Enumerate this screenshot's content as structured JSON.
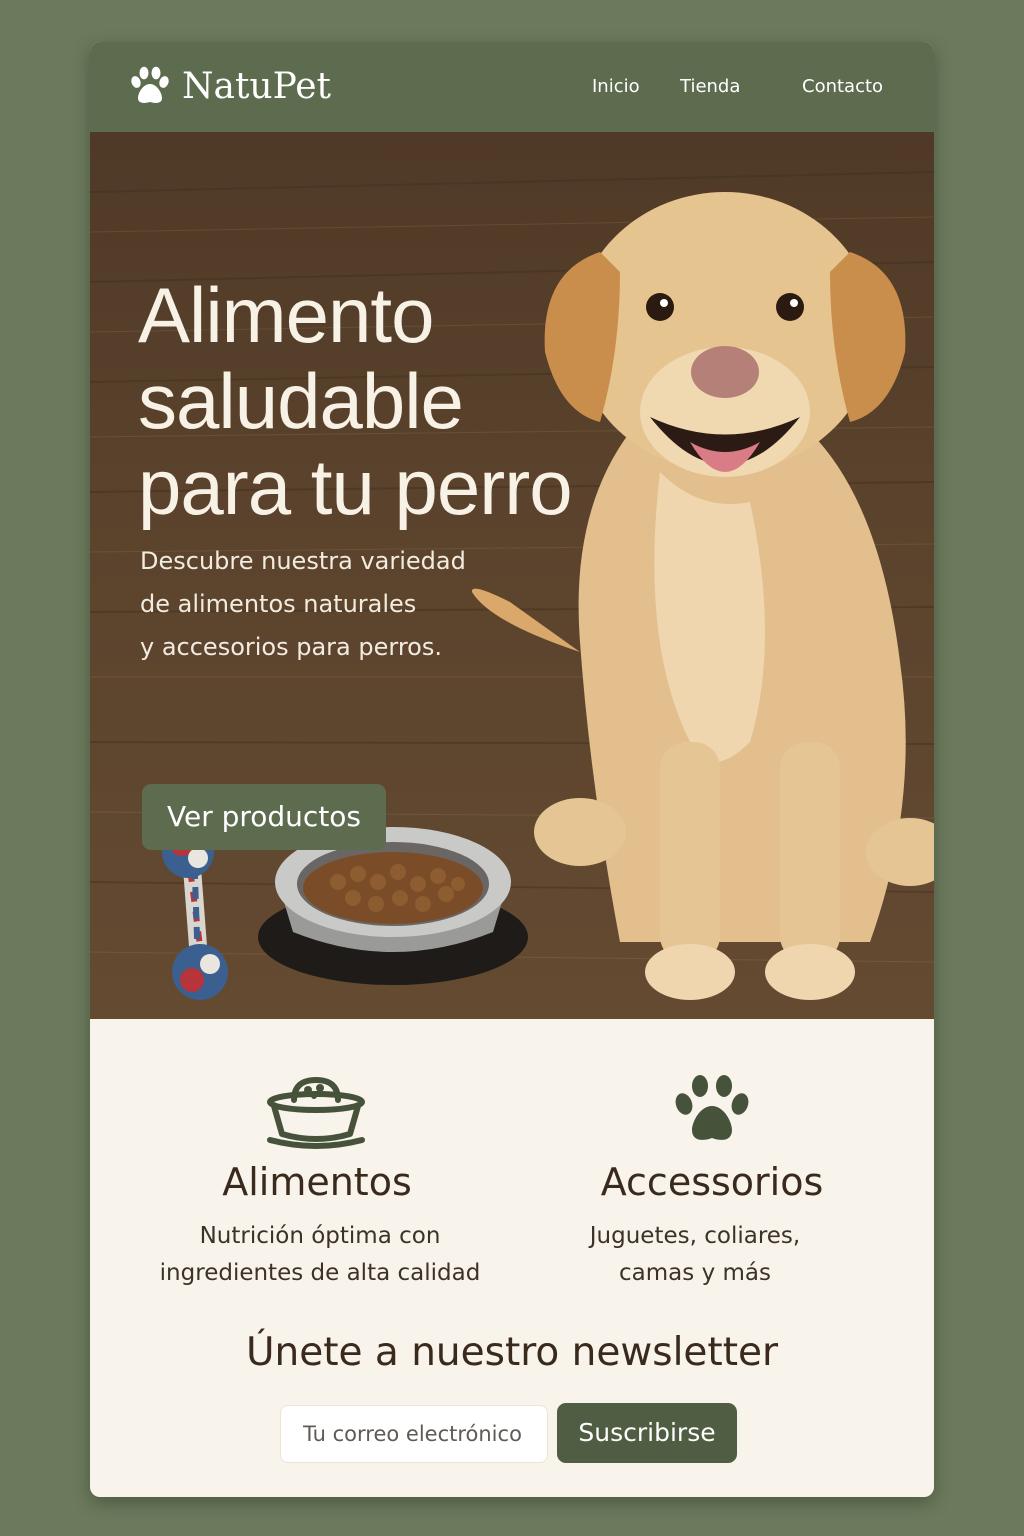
{
  "brand": {
    "name": "NatuPet",
    "logo_icon": "paw-icon"
  },
  "nav": {
    "inicio": "Inicio",
    "tienda": "Tienda",
    "contacto": "Contacto"
  },
  "hero": {
    "title_line1": "Alimento",
    "title_line2": "saludable",
    "title_line3": "para tu perro",
    "sub_line1": "Descubre nuestra variedad",
    "sub_line2": "de alimentos naturales",
    "sub_line3": "y accesorios para perros.",
    "cta_label": "Ver productos"
  },
  "features": [
    {
      "icon": "food-bowl-icon",
      "title": "Alimentos",
      "desc_line1": "Nutrición óptima con",
      "desc_line2": "ingredientes de alta calidad"
    },
    {
      "icon": "paw-icon",
      "title": "Accessorios",
      "desc_line1": "Juguetes, coliares,",
      "desc_line2": "camas y más"
    }
  ],
  "newsletter": {
    "title": "Únete a nuestro newsletter",
    "email_placeholder": "Tu correo electrónico",
    "submit_label": "Suscribirse"
  },
  "colors": {
    "page_bg": "#6b7a5c",
    "header_bg": "#5d6b4f",
    "cream": "#f8f3eb",
    "button": "#5d6b4f",
    "heading_text": "#3a2a1d"
  }
}
